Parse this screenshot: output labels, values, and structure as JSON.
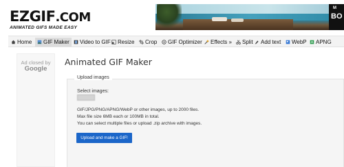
{
  "logo": {
    "main": "EZGIF",
    "dotcom": ".COM",
    "tagline": "ANIMATED GIFS MADE EASY"
  },
  "ad_banner": {
    "letter": "M",
    "brand": "BO"
  },
  "nav": {
    "items": [
      {
        "label": "Home",
        "icon": "home-icon"
      },
      {
        "label": "GIF Maker",
        "icon": "image-icon"
      },
      {
        "label": "Video to GIF",
        "icon": "film-icon"
      },
      {
        "label": "Resize",
        "icon": "resize-icon"
      },
      {
        "label": "Crop",
        "icon": "crop-icon"
      },
      {
        "label": "GIF Optimizer",
        "icon": "optimize-icon"
      },
      {
        "label": "Effects »",
        "icon": "effects-icon"
      },
      {
        "label": "Split",
        "icon": "split-icon"
      },
      {
        "label": "Add text",
        "icon": "text-icon"
      },
      {
        "label": "WebP",
        "icon": "webp-icon"
      },
      {
        "label": "APNG",
        "icon": "apng-icon"
      }
    ],
    "active_index": 1
  },
  "side_ad": {
    "line1": "Ad closed by",
    "line2": "Google"
  },
  "main": {
    "title": "Animated GIF Maker",
    "legend": "Upload images",
    "select_label": "Select images:",
    "info": [
      "GIF/JPG/PNG/APNG/WebP or other images, up to 2000 files.",
      "Max file size 6MB each or 100MB in total.",
      "You can select multiple files or upload .zip archive with images."
    ],
    "upload_button": "Upload and make a GIF!"
  },
  "colors": {
    "accent": "#1b66c9",
    "nav_bg": "#f3f3f3",
    "panel_bg": "#f5f5f5"
  }
}
